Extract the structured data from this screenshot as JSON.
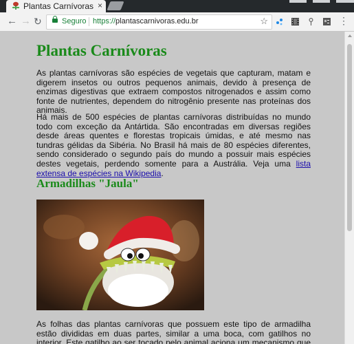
{
  "browser": {
    "tab_title": "Plantas Carnívoras",
    "tab_close": "×",
    "secure_label": "Seguro",
    "url_scheme": "https://",
    "url_host": "plantascarnivoras.edu.br",
    "nav": {
      "back": "←",
      "forward": "→",
      "reload": "↻"
    },
    "star": "☆",
    "extensions": [
      "dots-icon",
      "film-icon",
      "pin-icon",
      "es-icon"
    ]
  },
  "page": {
    "title": "Plantas Carnívoras",
    "intro": "As plantas carnívoras são espécies de vegetais que capturam, matam e digerem insetos ou outros pequenos animais, devido à presença de enzimas digestivas que extraem compostos nitrogenados e assim como fonte de nutrientes, dependem do nitrogênio presente nas proteínas dos animais.",
    "para2": "Há mais de 500 espécies de plantas carnívoras distribuídas no mundo todo com exceção da Antártida. São encontradas em diversas regiões desde áreas quentes e florestas tropicais úmidas, e até mesmo nas tundras gélidas da Sibéria. No Brasil há mais de 80 espécies diferentes, sendo considerado o segundo país do mundo a possuir mais espécies destes vegetais, perdendo somente para a Austrália. Veja uma",
    "link_text": "lista extensa de espécies na Wikipedia",
    "link_suffix": ".",
    "section_title": "Armadilhas \"Jaula\"",
    "para3": "As folhas das plantas carnívoras que possuem este tipo de armadilha estão divididas em duas partes, similar a uma boca, com gatilhos no interior. Este gatilho ao ser tocado pelo animal aciona um mecanismo que imediatamente"
  },
  "colors": {
    "heading": "#1a8a1a",
    "link": "#1a0dab",
    "page_bg": "#c8c8c8",
    "secure": "#188038"
  }
}
